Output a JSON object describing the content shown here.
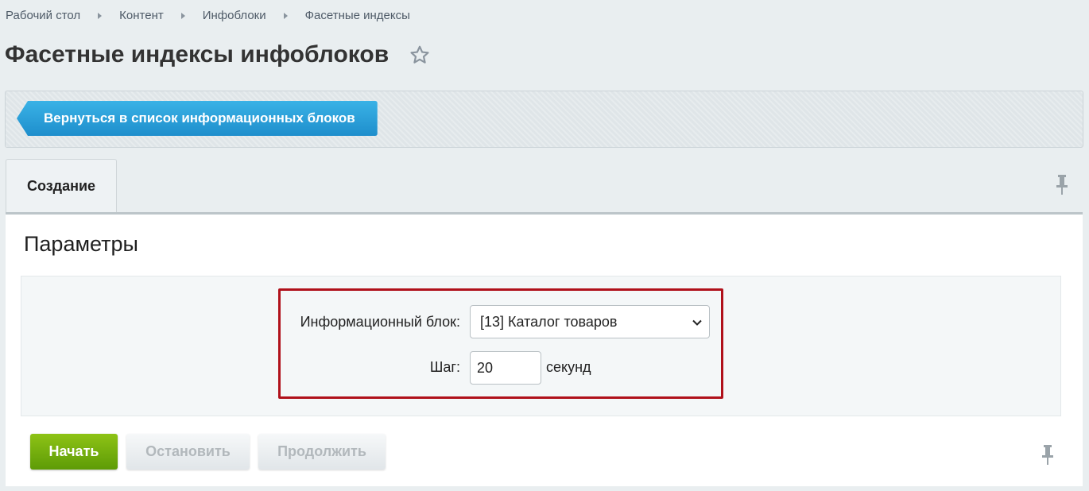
{
  "breadcrumb": [
    "Рабочий стол",
    "Контент",
    "Инфоблоки",
    "Фасетные индексы"
  ],
  "page_title": "Фасетные индексы инфоблоков",
  "toolbar": {
    "back_label": "Вернуться в список информационных блоков"
  },
  "tabs": [
    {
      "label": "Создание",
      "active": true
    }
  ],
  "section_title": "Параметры",
  "form": {
    "iblock_label": "Информационный блок:",
    "iblock_value": "[13] Каталог товаров",
    "step_label": "Шаг:",
    "step_value": "20",
    "step_suffix": "секунд"
  },
  "buttons": {
    "start": "Начать",
    "stop": "Остановить",
    "continue": "Продолжить"
  },
  "colors": {
    "accent_blue": "#2a9fdb",
    "start_green": "#74ad0c",
    "highlight_red": "#b0111b"
  }
}
